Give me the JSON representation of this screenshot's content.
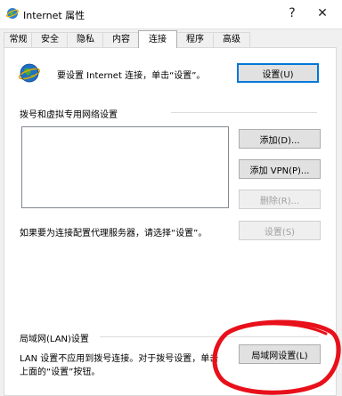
{
  "window": {
    "title": "Internet 属性",
    "help_glyph": "?",
    "close_glyph": "✕"
  },
  "tabs": [
    {
      "label": "常规"
    },
    {
      "label": "安全"
    },
    {
      "label": "隐私"
    },
    {
      "label": "内容"
    },
    {
      "label": "连接",
      "active": true
    },
    {
      "label": "程序"
    },
    {
      "label": "高级"
    }
  ],
  "connection": {
    "setup_text": "要设置 Internet 连接，单击“设置”。",
    "setup_button": "设置(U)"
  },
  "dialup": {
    "section_title": "拨号和虚拟专用网络设置",
    "add_button": "添加(D)...",
    "add_vpn_button": "添加 VPN(P)...",
    "remove_button": "删除(R)...",
    "proxy_text": "如果要为连接配置代理服务器，请选择“设置”。",
    "settings_button": "设置(S)"
  },
  "lan": {
    "section_title": "局域网(LAN)设置",
    "desc_line1": "LAN 设置不应用到拨号连接。对于拨号设置，单击",
    "desc_line2": "上面的“设置”按钮。",
    "lan_button": "局域网设置(L)"
  },
  "colors": {
    "annotation_circle": "#e8101a",
    "focus_border": "#0078d7"
  }
}
